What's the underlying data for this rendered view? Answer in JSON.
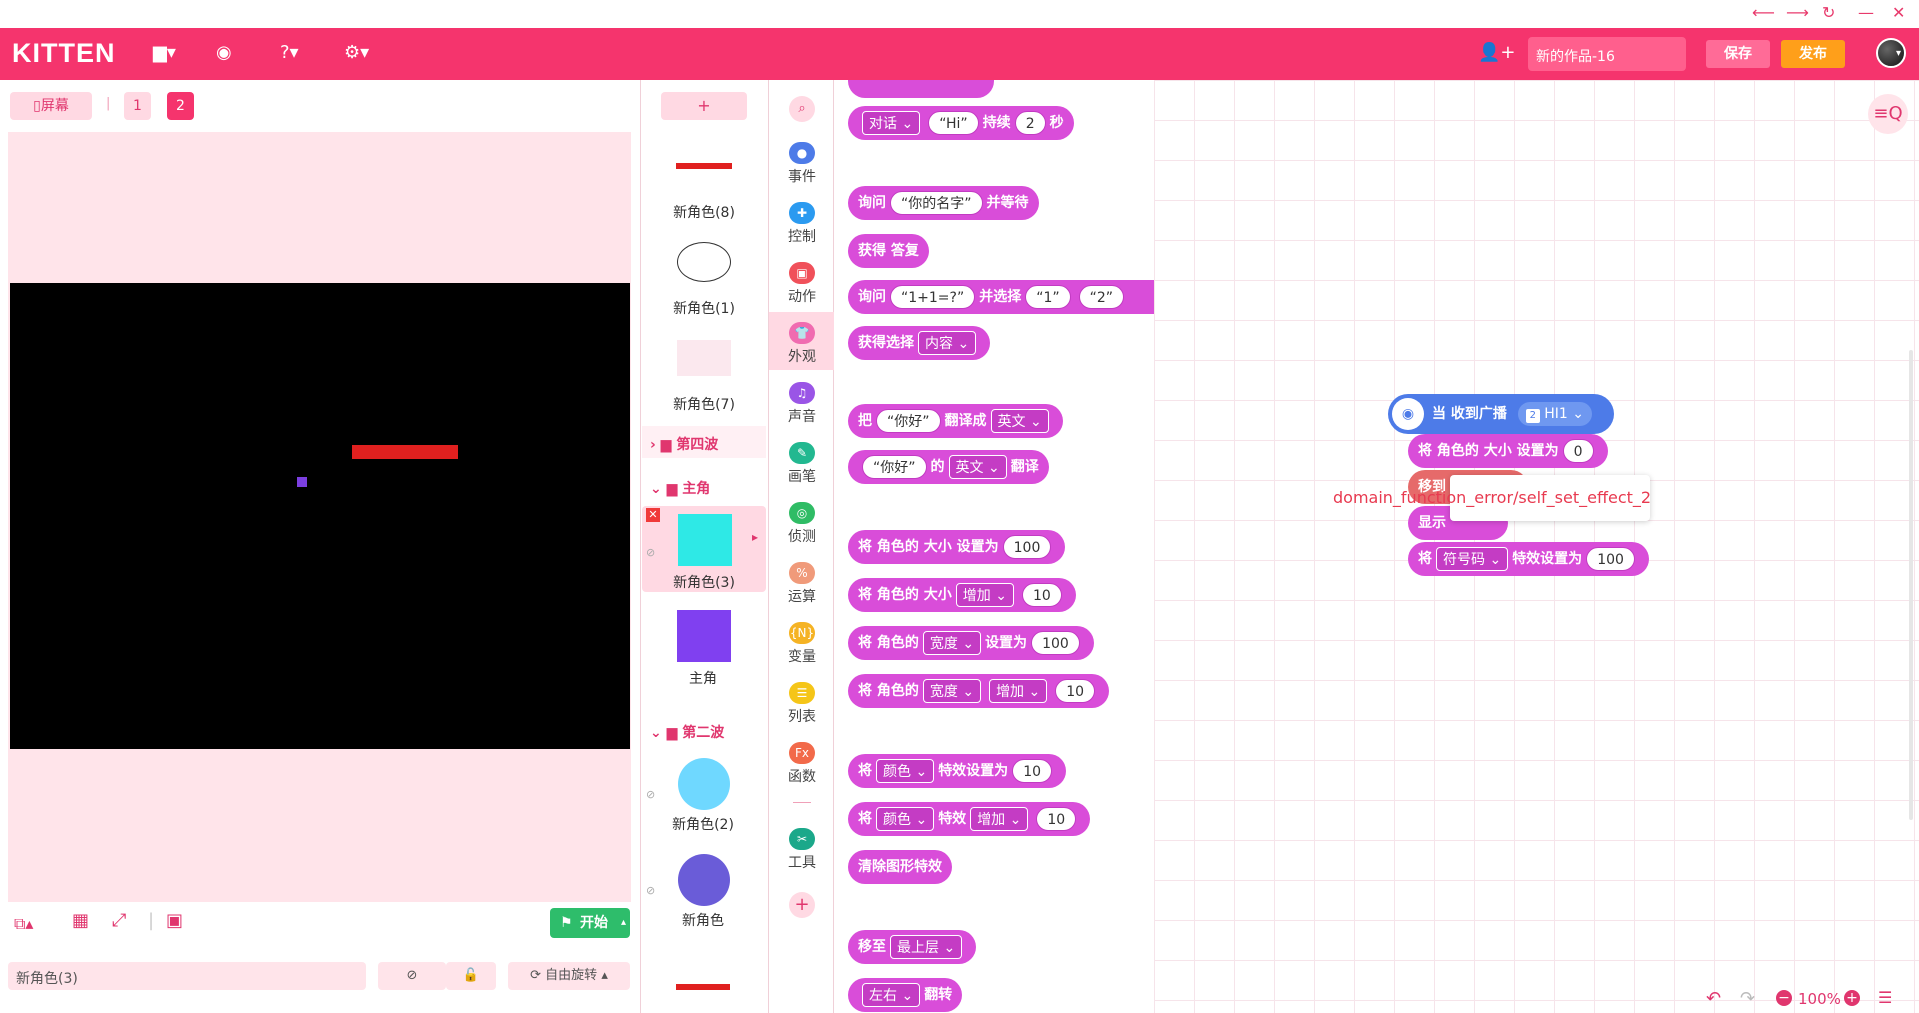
{
  "header": {
    "logo": "KITTEN",
    "project_name": "新的作品-16",
    "save_label": "保存",
    "publish_label": "发布"
  },
  "stage": {
    "screen_label": "屏幕",
    "scene_tabs": [
      "1",
      "2"
    ],
    "start_label": "开始",
    "sprite_name": "新角色(3)",
    "rotation_label": "自由旋转"
  },
  "sprites": {
    "items": [
      "新角色(8)",
      "新角色(1)",
      "新角色(7)",
      "新角色(3)",
      "主角",
      "新角色(2)",
      "新角色"
    ],
    "folders": [
      "第四波",
      "主角",
      "第二波"
    ],
    "add_label": "+"
  },
  "categories": [
    "事件",
    "控制",
    "动作",
    "外观",
    "声音",
    "画笔",
    "侦测",
    "运算",
    "变量",
    "列表",
    "函数",
    "工具"
  ],
  "palette": {
    "say": [
      "对话",
      "“Hi”",
      "持续",
      "2",
      "秒"
    ],
    "ask": [
      "询问",
      "“你的名字”",
      "并等待"
    ],
    "get_answer": "获得 答复",
    "ask_choice": [
      "询问",
      "“1+1=?”",
      "并选择",
      "“1”",
      "“2”"
    ],
    "get_choice": [
      "获得选择",
      "内容"
    ],
    "translate": [
      "把",
      "“你好”",
      "翻译成",
      "英文"
    ],
    "translate2": [
      "“你好”",
      "的",
      "英文",
      "翻译"
    ],
    "size_set": [
      "将 角色的 大小 设置为",
      "100"
    ],
    "size_inc": [
      "将 角色的 大小",
      "增加",
      "10"
    ],
    "dim_set": [
      "将 角色的",
      "宽度",
      "设置为",
      "100"
    ],
    "dim_inc": [
      "将 角色的",
      "宽度",
      "增加",
      "10"
    ],
    "effect_set": [
      "将",
      "颜色",
      "特效设置为",
      "10"
    ],
    "effect_inc": [
      "将",
      "颜色",
      "特效",
      "增加",
      "10"
    ],
    "clear_effects": "清除图形特效",
    "move_layer": [
      "移至",
      "最上层"
    ],
    "flip": [
      "左右",
      "翻转"
    ]
  },
  "script": {
    "hat": "当 收到广播",
    "broadcast": "HI1",
    "broadcast_num": "2",
    "size_label": "将 角色的 大小 设置为",
    "size_value": "0",
    "move_label": "移到",
    "show_label": "显示",
    "effect_prefix": "将",
    "effect_name": "符号码",
    "effect_label": "特效设置为",
    "effect_value": "100",
    "error": "domain_function_error/self_set_effect_2"
  },
  "zoom": "100%",
  "colors": {
    "brand": "#f5346d",
    "looks": "#d94dd9",
    "events": "#4d7be8",
    "start": "#2ebd6b"
  }
}
